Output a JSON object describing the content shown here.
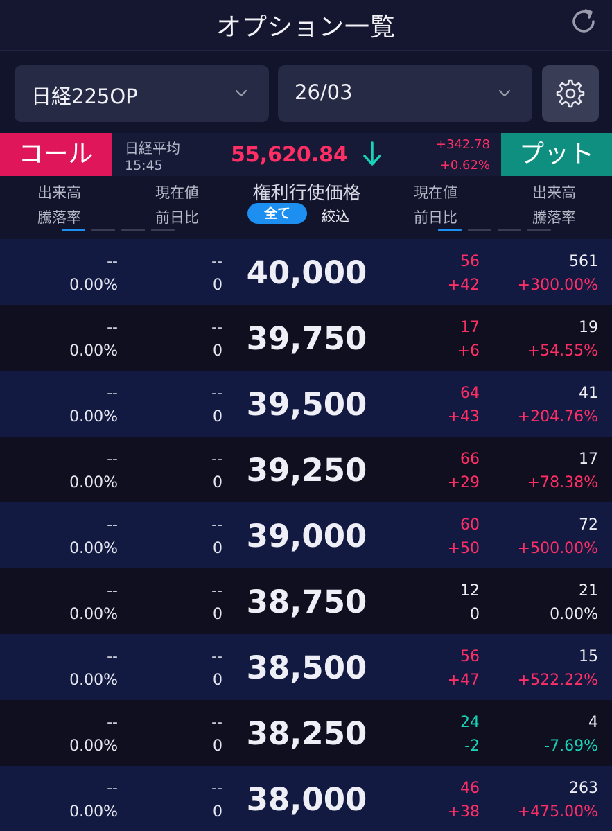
{
  "header": {
    "title": "オプション一覧"
  },
  "selectors": {
    "underlying": "日経225OP",
    "contract_month": "26/03"
  },
  "index": {
    "call_label": "コール",
    "put_label": "プット",
    "name": "日経平均",
    "time": "15:45",
    "price": "55,620.84",
    "change": "+342.78",
    "change_pct": "+0.62%",
    "direction": "down-arrow"
  },
  "columns": {
    "call_volume": "出来高",
    "call_rate": "騰落率",
    "call_price": "現在値",
    "call_change": "前日比",
    "strike": "権利行使価格",
    "filter_all": "全て",
    "filter_narrow": "絞込",
    "put_price": "現在値",
    "put_change": "前日比",
    "put_volume": "出来高",
    "put_rate": "騰落率"
  },
  "colors": {
    "up": "#ff2f66",
    "down": "#19d3b8",
    "call": "#e0165a",
    "put": "#0f8f7f",
    "accent": "#1c8ff0"
  },
  "rows": [
    {
      "call_vol": "--",
      "call_rate": "0.00%",
      "call_price": "--",
      "call_chg": "0",
      "strike": "40,000",
      "put_price": "56",
      "put_chg": "+42",
      "put_vol": "561",
      "put_rate": "+300.00%",
      "trend": "up"
    },
    {
      "call_vol": "--",
      "call_rate": "0.00%",
      "call_price": "--",
      "call_chg": "0",
      "strike": "39,750",
      "put_price": "17",
      "put_chg": "+6",
      "put_vol": "19",
      "put_rate": "+54.55%",
      "trend": "up"
    },
    {
      "call_vol": "--",
      "call_rate": "0.00%",
      "call_price": "--",
      "call_chg": "0",
      "strike": "39,500",
      "put_price": "64",
      "put_chg": "+43",
      "put_vol": "41",
      "put_rate": "+204.76%",
      "trend": "up"
    },
    {
      "call_vol": "--",
      "call_rate": "0.00%",
      "call_price": "--",
      "call_chg": "0",
      "strike": "39,250",
      "put_price": "66",
      "put_chg": "+29",
      "put_vol": "17",
      "put_rate": "+78.38%",
      "trend": "up"
    },
    {
      "call_vol": "--",
      "call_rate": "0.00%",
      "call_price": "--",
      "call_chg": "0",
      "strike": "39,000",
      "put_price": "60",
      "put_chg": "+50",
      "put_vol": "72",
      "put_rate": "+500.00%",
      "trend": "up"
    },
    {
      "call_vol": "--",
      "call_rate": "0.00%",
      "call_price": "--",
      "call_chg": "0",
      "strike": "38,750",
      "put_price": "12",
      "put_chg": "0",
      "put_vol": "21",
      "put_rate": "0.00%",
      "trend": "flat"
    },
    {
      "call_vol": "--",
      "call_rate": "0.00%",
      "call_price": "--",
      "call_chg": "0",
      "strike": "38,500",
      "put_price": "56",
      "put_chg": "+47",
      "put_vol": "15",
      "put_rate": "+522.22%",
      "trend": "up"
    },
    {
      "call_vol": "--",
      "call_rate": "0.00%",
      "call_price": "--",
      "call_chg": "0",
      "strike": "38,250",
      "put_price": "24",
      "put_chg": "-2",
      "put_vol": "4",
      "put_rate": "-7.69%",
      "trend": "down"
    },
    {
      "call_vol": "--",
      "call_rate": "0.00%",
      "call_price": "--",
      "call_chg": "0",
      "strike": "38,000",
      "put_price": "46",
      "put_chg": "+38",
      "put_vol": "263",
      "put_rate": "+475.00%",
      "trend": "up"
    }
  ]
}
